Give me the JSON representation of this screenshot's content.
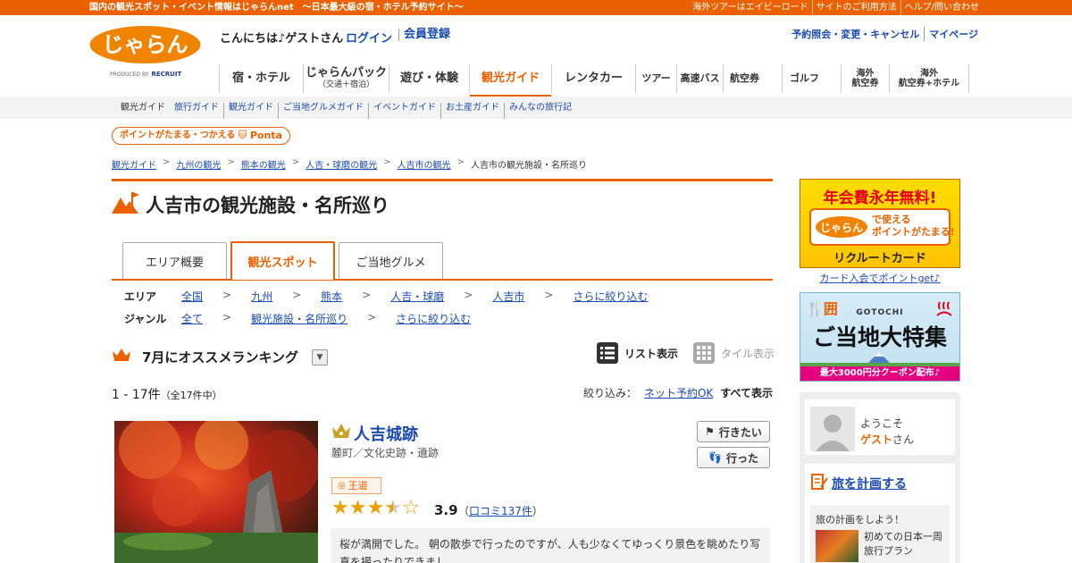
{
  "topbar": {
    "left": "国内の観光スポット・イベント情報はじゃらんnet　～日本最大級の宿・ホテル予約サイト～",
    "right": [
      "海外ツアーはエイビーロード",
      "サイトのご利用方法",
      "ヘルプ/問い合わせ"
    ]
  },
  "header": {
    "logo_text": "じゃらん",
    "produced_by": "PRODUCED BY",
    "recruit": "RECRUIT",
    "greeting": "こんにちは♪ゲストさん",
    "login": "ログイン",
    "register": "会員登録",
    "right_links": [
      "予約照会・変更・キャンセル",
      "マイページ"
    ]
  },
  "nav": {
    "items": [
      {
        "label": "宿・ホテル",
        "sub": ""
      },
      {
        "label": "じゃらんパック",
        "sub": "（交通＋宿泊）"
      },
      {
        "label": "遊び・体験",
        "sub": ""
      },
      {
        "label": "観光ガイド",
        "sub": ""
      },
      {
        "label": "レンタカー",
        "sub": ""
      },
      {
        "label": "ツアー",
        "sub": ""
      },
      {
        "label": "高速バス",
        "sub": ""
      },
      {
        "label": "航空券",
        "sub": ""
      },
      {
        "label": "ゴルフ",
        "sub": ""
      },
      {
        "label": "海外",
        "sub": "航空券"
      },
      {
        "label": "海外",
        "sub": "航空券+ホテル"
      }
    ]
  },
  "subnav": {
    "current": "観光ガイド",
    "items": [
      "旅行ガイド",
      "観光ガイド",
      "ご当地グルメガイド",
      "イベントガイド",
      "お土産ガイド",
      "みんなの旅行記"
    ]
  },
  "ponta": {
    "text": "ポイントがたまる・つかえる",
    "brand": "Ponta"
  },
  "breadcrumb": {
    "links": [
      "観光ガイド",
      "九州の観光",
      "熊本の観光",
      "人吉・球磨の観光",
      "人吉市の観光"
    ],
    "current": "人吉市の観光施設・名所巡り",
    "sep": ">"
  },
  "page": {
    "title": "人吉市の観光施設・名所巡り"
  },
  "tabs": [
    "エリア概要",
    "観光スポット",
    "ご当地グルメ"
  ],
  "filters": {
    "area_label": "エリア",
    "area": [
      "全国",
      "九州",
      "熊本",
      "人吉・球磨",
      "人吉市",
      "さらに絞り込む"
    ],
    "genre_label": "ジャンル",
    "genre": [
      "全て",
      "観光施設・名所巡り",
      "さらに絞り込む"
    ],
    "sep": ">"
  },
  "ranking": {
    "title": "7月にオススメランキング",
    "dropdown": "▼",
    "list_view": "リスト表示",
    "tile_view": "タイル表示"
  },
  "results": {
    "count": "1 - 17件",
    "total": "（全17件中）",
    "filter_label": "絞り込み：",
    "filter_online": "ネット予約OK",
    "filter_all": "すべて表示"
  },
  "spot": {
    "name": "人吉城跡",
    "category": "麓町／文化史跡・遺跡",
    "badge": "王道",
    "rating": 3.9,
    "score": "3.9",
    "reviews_prefix": "（",
    "reviews_link": "口コミ137件",
    "reviews_suffix": "）",
    "want": "行きたい",
    "went": "行った",
    "review": "桜が満開でした。 朝の散歩で行ったのですが、人も少なくてゆっくり景色を眺めたり写真を撮ったりできまし"
  },
  "ads": {
    "ad1_title": "年会費永年無料!",
    "ad1_logo": "じゃらん",
    "ad1_line1": "で使える",
    "ad1_line2": "ポイントがたまる!",
    "ad1_card": "リクルートカード",
    "ad1_link": "カード入会でポイントget♪",
    "ad2_icon": "囲",
    "ad2_small": "GOTOCHI",
    "ad2_big": "ご当地大特集",
    "ad2_banner": "最大3000円分クーポン配布♪"
  },
  "sidebar": {
    "welcome1": "ようこそ",
    "guest": "ゲスト",
    "san": "さん",
    "plan_link": "旅を計画する",
    "plan_text": "旅の計画をしよう！",
    "plan_item": "初めての日本一周旅行プラン"
  },
  "colors": {
    "accent": "#eb6100",
    "link": "#1a4bb0"
  }
}
